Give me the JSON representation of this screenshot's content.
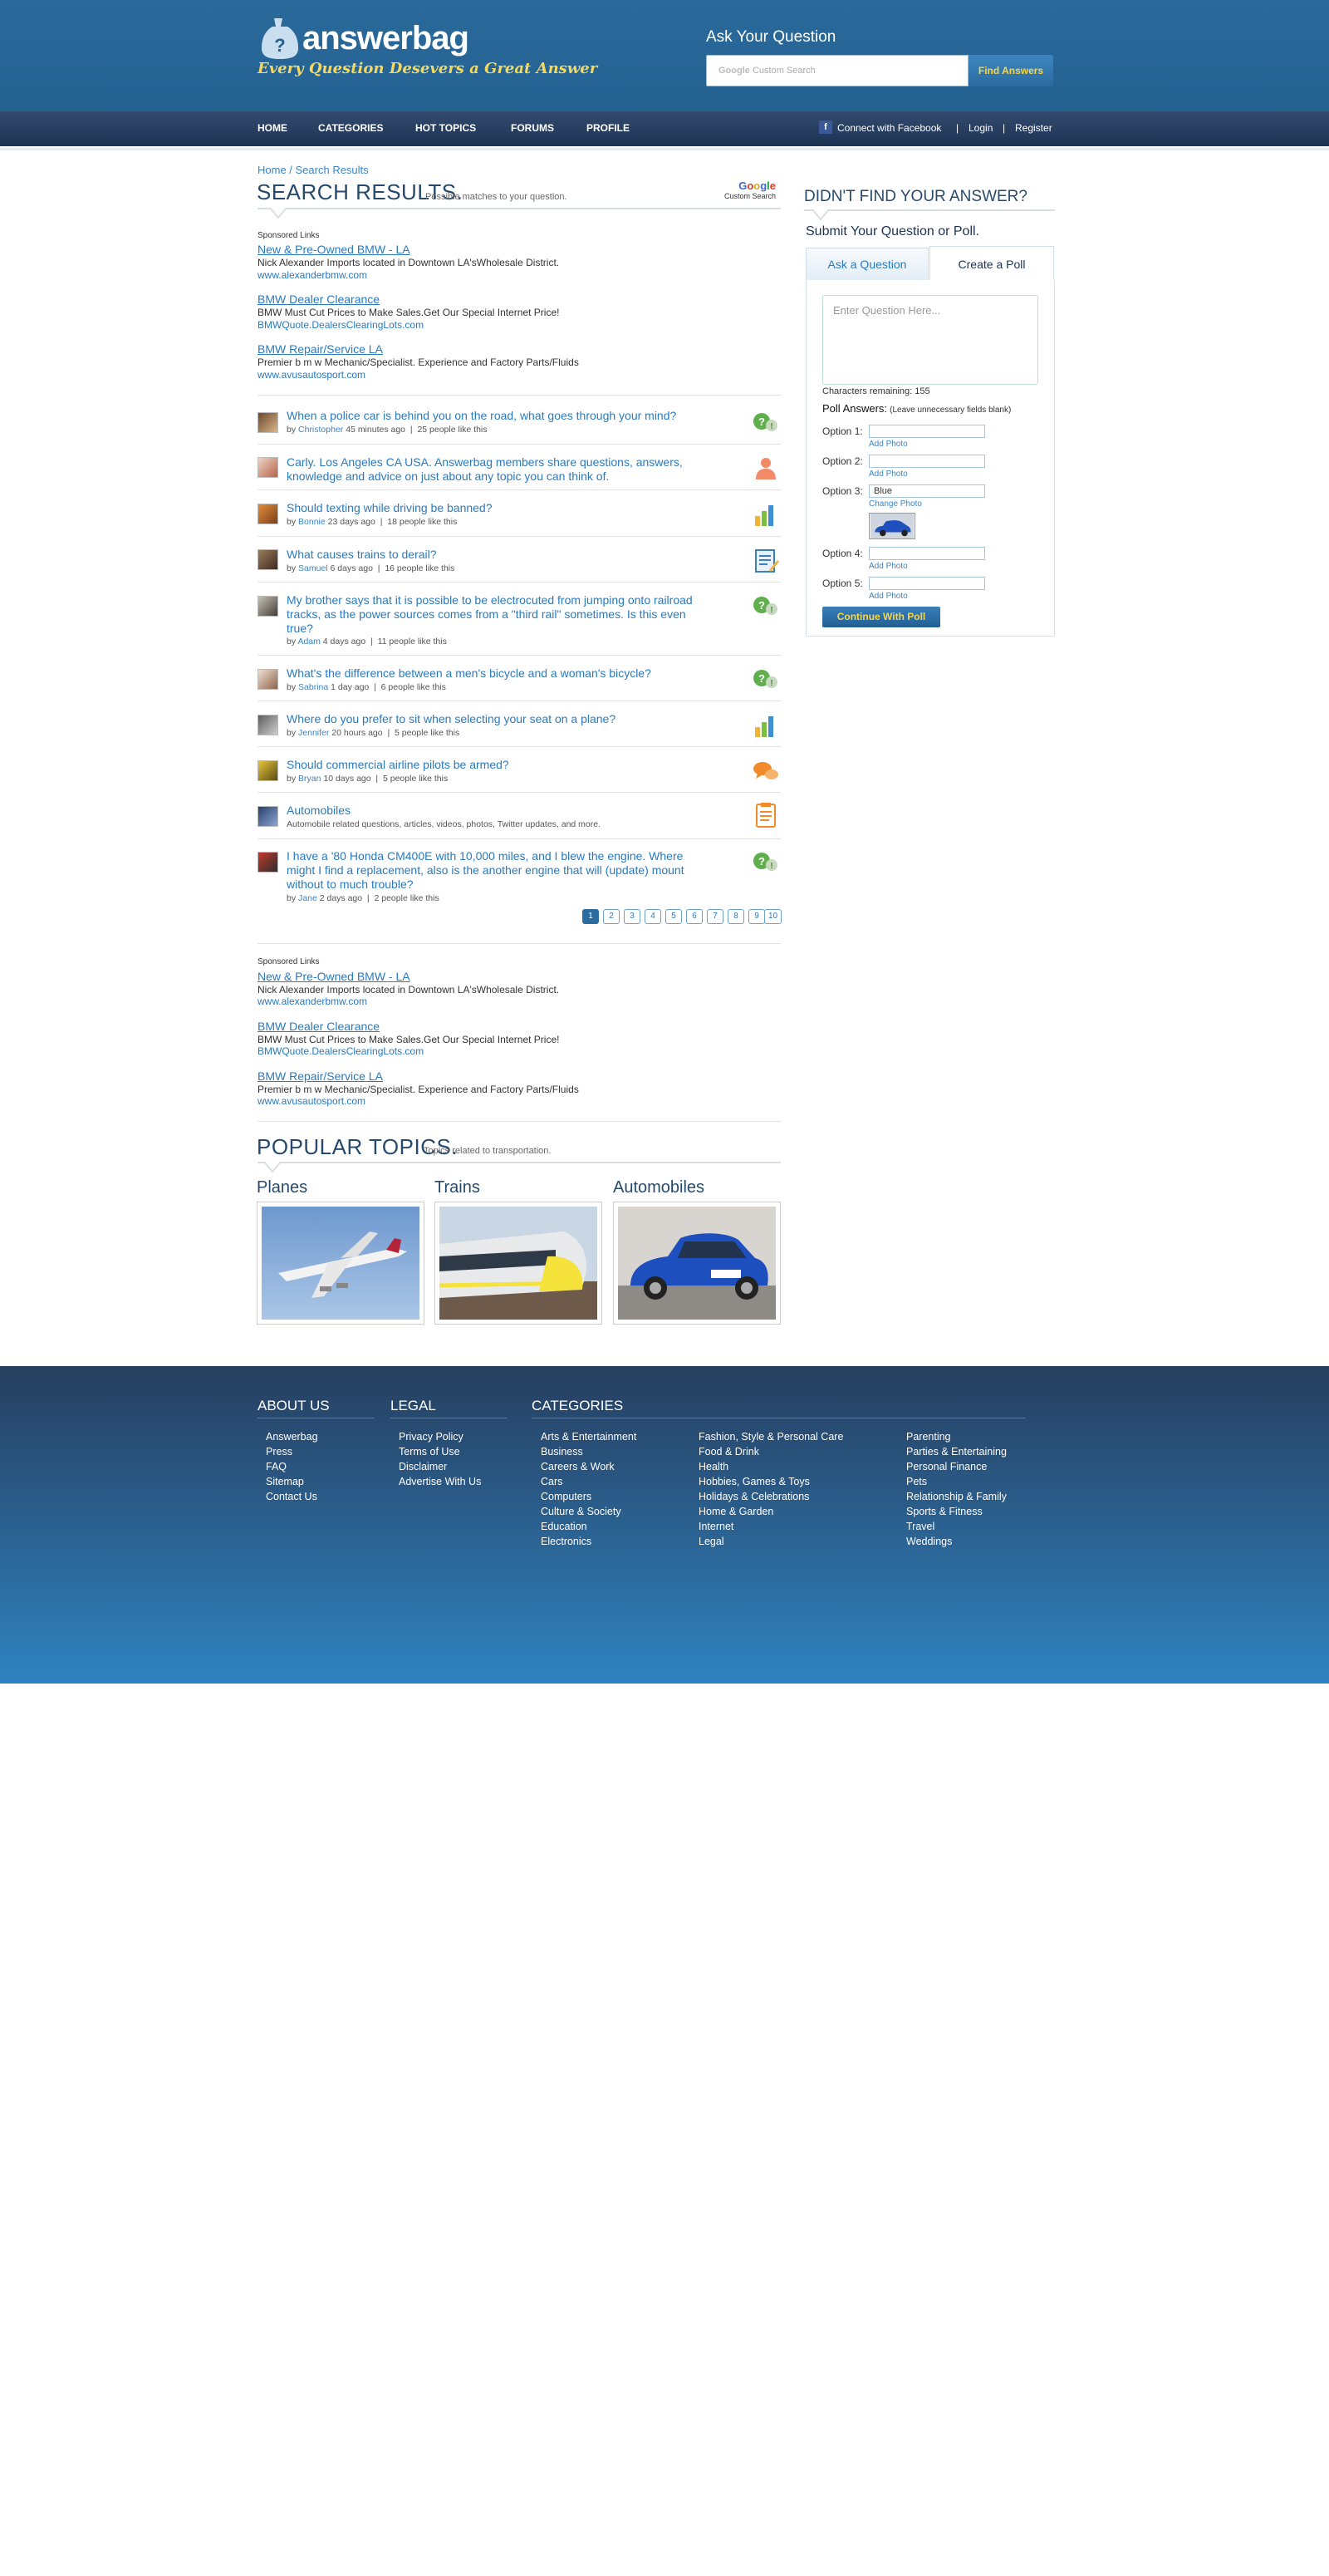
{
  "header": {
    "logo_text": "answerbag",
    "tagline": "Every Question Desevers a Great Answer",
    "ask_title": "Ask Your Question",
    "search_placeholder": "Custom Search",
    "search_brand": "Google",
    "find_button": "Find Answers"
  },
  "nav": {
    "items": [
      "HOME",
      "CATEGORIES",
      "HOT TOPICS",
      "FORUMS",
      "PROFILE"
    ],
    "connect_facebook": "Connect with Facebook",
    "login": "Login",
    "register": "Register",
    "separator": "|"
  },
  "breadcrumb": "Home / Search Results",
  "results": {
    "title": "SEARCH RESULTS.",
    "subtitle": "Possible matches to your question.",
    "google_badge": "Google",
    "google_badge_sub": "Custom Search"
  },
  "sponsored_top": {
    "label": "Sponsored Links",
    "links": [
      {
        "title": "New & Pre-Owned BMW - LA",
        "desc": "Nick Alexander Imports located in Downtown LA'sWholesale District.",
        "url": "www.alexanderbmw.com"
      },
      {
        "title": "BMW Dealer Clearance",
        "desc": "BMW Must Cut Prices to Make Sales.Get Our Special Internet Price!",
        "url": "BMWQuote.DealersClearingLots.com"
      },
      {
        "title": "BMW Repair/Service LA",
        "desc": "Premier b m w Mechanic/Specialist. Experience and Factory Parts/Fluids",
        "url": "www.avusautosport.com"
      }
    ]
  },
  "questions": [
    {
      "title": "When a police car is behind you on the road, what goes through your mind?",
      "meta_by": "by",
      "user": "Christopher",
      "time": "45 minutes ago",
      "likes": "25 people like this",
      "icon": "question-answer-icon"
    },
    {
      "title": "Carly. Los Angeles CA USA. Answerbag members share questions, answers, knowledge and advice on just about any topic you can think of.",
      "user": "",
      "time": "",
      "likes": "",
      "icon": "person-icon"
    },
    {
      "title": "Should texting while driving be banned?",
      "meta_by": "by",
      "user": "Bonnie",
      "time": "23 days ago",
      "likes": "18 people like this",
      "icon": "poll-bars-icon"
    },
    {
      "title": "What causes trains to derail?",
      "meta_by": "by",
      "user": "Samuel",
      "time": "6 days ago",
      "likes": "16 people like this",
      "icon": "article-icon"
    },
    {
      "title": "My brother says that it is possible to be electrocuted from jumping onto railroad tracks, as the power sources comes from a \"third rail\" sometimes. Is this even true?",
      "meta_by": "by",
      "user": "Adam",
      "time": "4 days ago",
      "likes": "11 people like this",
      "icon": "question-answer-icon"
    },
    {
      "title": "What's the difference between a men's bicycle and a woman's bicycle?",
      "meta_by": "by",
      "user": "Sabrina",
      "time": "1 day ago",
      "likes": "6 people like this",
      "icon": "question-answer-icon"
    },
    {
      "title": "Where do you prefer to sit when selecting your seat on a plane?",
      "meta_by": "by",
      "user": "Jennifer",
      "time": "20 hours ago",
      "likes": "5 people like this",
      "icon": "poll-bars-icon"
    },
    {
      "title": "Should commercial airline pilots be armed?",
      "meta_by": "by",
      "user": "Bryan",
      "time": "10 days ago",
      "likes": "5 people like this",
      "icon": "discussion-icon"
    },
    {
      "title": "Automobiles",
      "desc": "Automobile related questions, articles, videos, photos, Twitter updates, and more.",
      "icon": "topic-icon"
    },
    {
      "title": "I have a '80 Honda CM400E with 10,000 miles, and I blew the engine. Where might I find a replacement, also is the another engine that will (update) mount without to much trouble?",
      "meta_by": "by",
      "user": "Jane",
      "time": "2 days ago",
      "likes": "2 people like this",
      "icon": "question-answer-icon"
    }
  ],
  "pagination": [
    "1",
    "2",
    "3",
    "4",
    "5",
    "6",
    "7",
    "8",
    "9",
    "10"
  ],
  "sponsored_bottom": {
    "label": "Sponsored Links",
    "links": [
      {
        "title": "New & Pre-Owned BMW - LA",
        "desc": "Nick Alexander Imports located in Downtown LA'sWholesale District.",
        "url": "www.alexanderbmw.com"
      },
      {
        "title": "BMW Dealer Clearance",
        "desc": "BMW Must Cut Prices to Make Sales.Get Our Special Internet Price!",
        "url": "BMWQuote.DealersClearingLots.com"
      },
      {
        "title": "BMW Repair/Service LA",
        "desc": "Premier b m w Mechanic/Specialist. Experience and Factory Parts/Fluids",
        "url": "www.avusautosport.com"
      }
    ]
  },
  "popular": {
    "title": "POPULAR TOPICS.",
    "subtitle": "Topics related to transportation.",
    "topics": [
      "Planes",
      "Trains",
      "Automobiles"
    ]
  },
  "sidebar": {
    "title": "DIDN'T FIND YOUR ANSWER?",
    "submit_label": "Submit Your Question or Poll.",
    "tab_ask": "Ask a Question",
    "tab_poll": "Create a Poll",
    "question_placeholder": "Enter Question Here...",
    "chars_remaining": "Characters remaining: 155",
    "poll_answers_label": "Poll Answers:",
    "poll_answers_hint": "(Leave unnecessary fields blank)",
    "options": [
      {
        "label": "Option 1:",
        "value": "",
        "link": "Add Photo"
      },
      {
        "label": "Option 2:",
        "value": "",
        "link": "Add Photo"
      },
      {
        "label": "Option 3:",
        "value": "Blue",
        "link": "Change Photo"
      },
      {
        "label": "Option 4:",
        "value": "",
        "link": "Add Photo"
      },
      {
        "label": "Option 5:",
        "value": "",
        "link": "Add Photo"
      }
    ],
    "continue_button": "Continue With Poll"
  },
  "footer": {
    "about": {
      "title": "ABOUT US",
      "links": [
        "Answerbag",
        "Press",
        "FAQ",
        "Sitemap",
        "Contact Us"
      ]
    },
    "legal": {
      "title": "LEGAL",
      "links": [
        "Privacy Policy",
        "Terms of Use",
        "Disclaimer",
        "Advertise With Us"
      ]
    },
    "categories": {
      "title": "CATEGORIES",
      "col1": [
        "Arts & Entertainment",
        "Business",
        "Careers & Work",
        "Cars",
        "Computers",
        "Culture & Society",
        "Education",
        "Electronics"
      ],
      "col2": [
        "Fashion, Style & Personal Care",
        "Food & Drink",
        "Health",
        "Hobbies, Games & Toys",
        "Holidays & Celebrations",
        "Home & Garden",
        "Internet",
        "Legal"
      ],
      "col3": [
        "Parenting",
        "Parties & Entertaining",
        "Personal Finance",
        "Pets",
        "Relationship & Family",
        "Sports & Fitness",
        "Travel",
        "Weddings"
      ]
    }
  },
  "colors": {
    "brand_blue": "#236191",
    "nav_dark": "#1d3354",
    "link": "#2a7ac0",
    "accent_yellow": "#f4d862"
  }
}
